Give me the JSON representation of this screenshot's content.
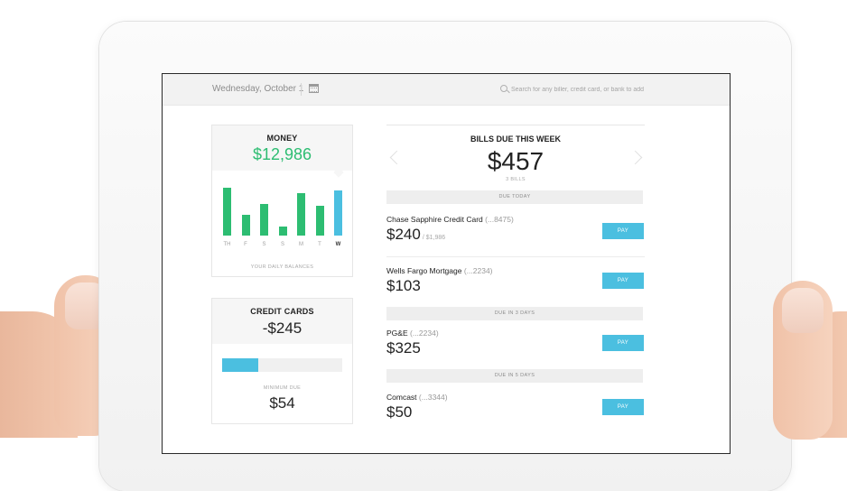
{
  "topbar": {
    "date": "Wednesday, October 1",
    "search_placeholder": "Search for any biller, credit card, or bank to add"
  },
  "money": {
    "title": "MONEY",
    "amount": "$12,986",
    "caption": "YOUR DAILY BALANCES",
    "bars": [
      {
        "day": "TH",
        "level": 0.78,
        "today": false
      },
      {
        "day": "F",
        "level": 0.34,
        "today": false
      },
      {
        "day": "S",
        "level": 0.52,
        "today": false
      },
      {
        "day": "S",
        "level": 0.15,
        "today": false
      },
      {
        "day": "M",
        "level": 0.69,
        "today": false
      },
      {
        "day": "T",
        "level": 0.49,
        "today": false
      },
      {
        "day": "W",
        "level": 0.74,
        "today": true
      }
    ]
  },
  "credit_cards": {
    "title": "CREDIT CARDS",
    "amount": "-$245",
    "progress": 0.3,
    "min_label": "MINIMUM DUE",
    "min_amount": "$54"
  },
  "bills": {
    "title": "BILLS DUE THIS WEEK",
    "total": "$457",
    "count": "3 BILLS",
    "sections": [
      "DUE TODAY",
      "DUE IN 3 DAYS",
      "DUE IN 5 DAYS"
    ],
    "items": [
      {
        "name": "Chase Sapphire Credit Card",
        "account": "(...8475)",
        "amount": "$240",
        "of": "/ $1,986",
        "action": "PAY"
      },
      {
        "name": "Wells Fargo Mortgage",
        "account": "(...2234)",
        "amount": "$103",
        "of": "",
        "action": "PAY"
      },
      {
        "name": "PG&E",
        "account": "(...2234)",
        "amount": "$325",
        "of": "",
        "action": "PAY"
      },
      {
        "name": "Comcast",
        "account": "(...3344)",
        "amount": "$50",
        "of": "",
        "action": "PAY"
      }
    ]
  },
  "colors": {
    "accent_blue": "#4bbfe0",
    "money_green": "#2dbd72"
  }
}
